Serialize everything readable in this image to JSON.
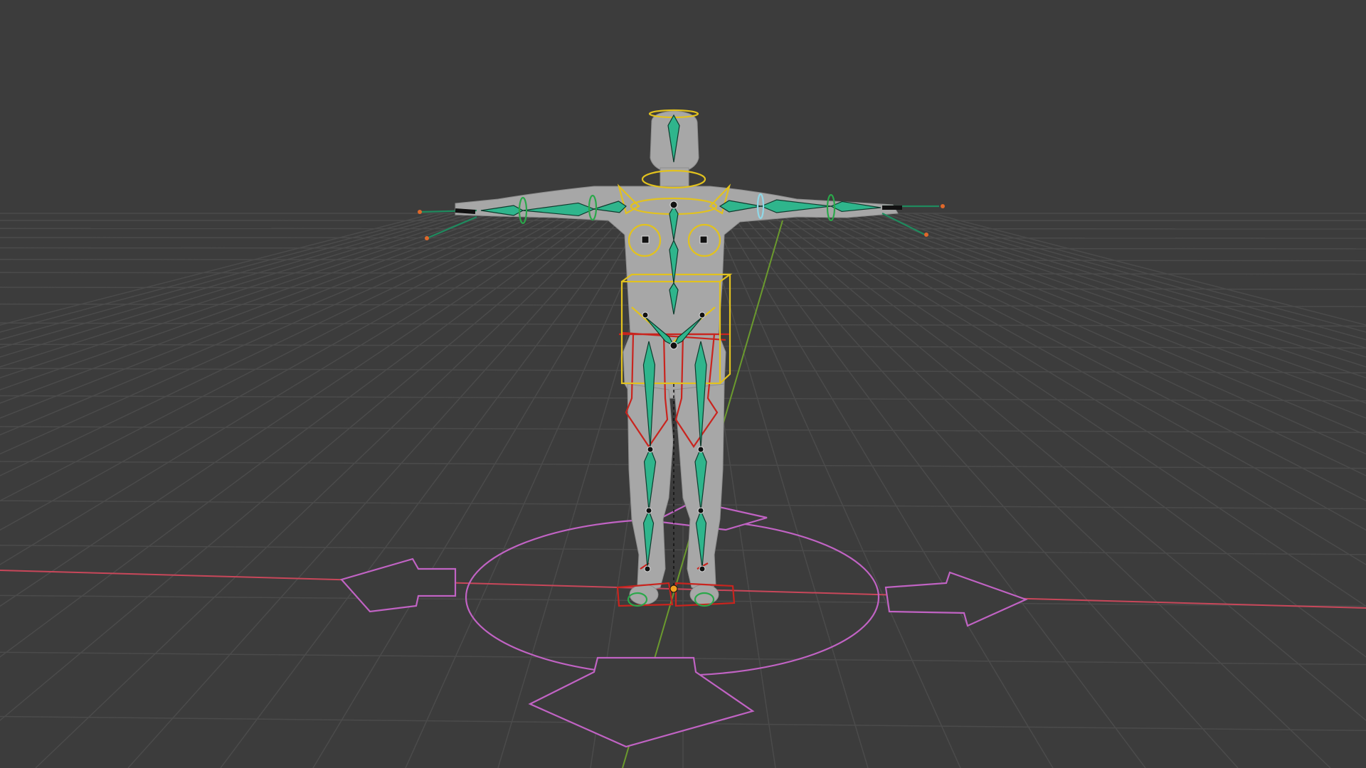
{
  "viewport": {
    "label": "3D viewport",
    "shading": "solid",
    "view": "perspective",
    "grid_visible": true,
    "background_color": "#3c3c3c",
    "grid_color": "#4a4a4a"
  },
  "axes": {
    "x_axis_color": "#c8475a",
    "y_axis_color": "#6b9a2e"
  },
  "scene": {
    "character_mesh": {
      "name": "character-mesh",
      "color": "#a8a8a8"
    },
    "armature": {
      "bone_color": "#2fb58c",
      "head_controls_color": "#e2c21e",
      "leg_ik_controls_color": "#c9241e",
      "finger_tips_color": "#e0682a",
      "shoulder_marker_color": "#8fd8e8"
    },
    "root_control": {
      "name": "root-control",
      "color": "#c163c4"
    },
    "origin": {
      "name": "object-origin",
      "color": "#f0a020"
    }
  }
}
